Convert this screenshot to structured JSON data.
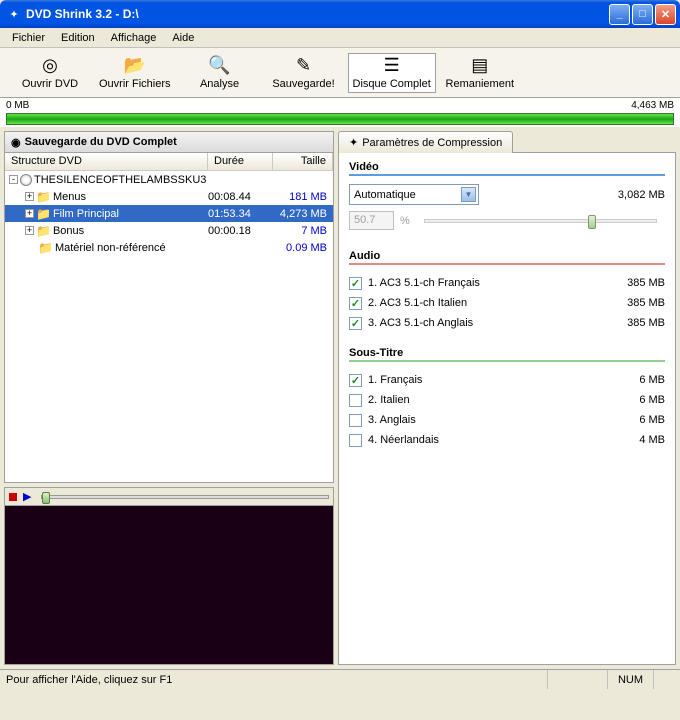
{
  "window": {
    "title": "DVD Shrink 3.2 - D:\\"
  },
  "menu": {
    "file": "Fichier",
    "edit": "Edition",
    "view": "Affichage",
    "help": "Aide"
  },
  "toolbar": {
    "open_dvd": "Ouvrir DVD",
    "open_files": "Ouvrir Fichiers",
    "analyse": "Analyse",
    "backup": "Sauvegarde!",
    "full_disc": "Disque Complet",
    "reauthor": "Remaniement"
  },
  "sizebar": {
    "min": "0 MB",
    "max": "4,463 MB"
  },
  "left": {
    "header": "Sauvegarde du DVD Complet",
    "cols": {
      "structure": "Structure DVD",
      "duration": "Durée",
      "size": "Taille"
    },
    "rows": [
      {
        "label": "THESILENCEOFTHELAMBSSKU3",
        "duration": "",
        "size": "",
        "type": "dvd",
        "indent": 0,
        "exp": "-"
      },
      {
        "label": "Menus",
        "duration": "00:08.44",
        "size": "181 MB",
        "type": "folder",
        "indent": 1,
        "exp": "+"
      },
      {
        "label": "Film Principal",
        "duration": "01:53.34",
        "size": "4,273 MB",
        "type": "folder",
        "indent": 1,
        "exp": "+",
        "sel": true
      },
      {
        "label": "Bonus",
        "duration": "00:00.18",
        "size": "7 MB",
        "type": "folder",
        "indent": 1,
        "exp": "+"
      },
      {
        "label": "Matériel non-référencé",
        "duration": "",
        "size": "0.09 MB",
        "type": "folder",
        "indent": 1,
        "exp": ""
      }
    ]
  },
  "right": {
    "tab": "Paramètres de Compression",
    "video": {
      "heading": "Vidéo",
      "mode": "Automatique",
      "size": "3,082 MB",
      "ratio": "50.7",
      "pct": "%"
    },
    "audio": {
      "heading": "Audio",
      "items": [
        {
          "label": "1. AC3 5.1-ch Français",
          "size": "385 MB",
          "checked": true
        },
        {
          "label": "2. AC3 5.1-ch Italien",
          "size": "385 MB",
          "checked": true
        },
        {
          "label": "3. AC3 5.1-ch Anglais",
          "size": "385 MB",
          "checked": true
        }
      ]
    },
    "sub": {
      "heading": "Sous-Titre",
      "items": [
        {
          "label": "1. Français",
          "size": "6 MB",
          "checked": true
        },
        {
          "label": "2. Italien",
          "size": "6 MB",
          "checked": false
        },
        {
          "label": "3. Anglais",
          "size": "6 MB",
          "checked": false
        },
        {
          "label": "4. Néerlandais",
          "size": "4 MB",
          "checked": false
        }
      ]
    }
  },
  "status": {
    "help": "Pour afficher l'Aide, cliquez sur F1",
    "num": "NUM"
  }
}
